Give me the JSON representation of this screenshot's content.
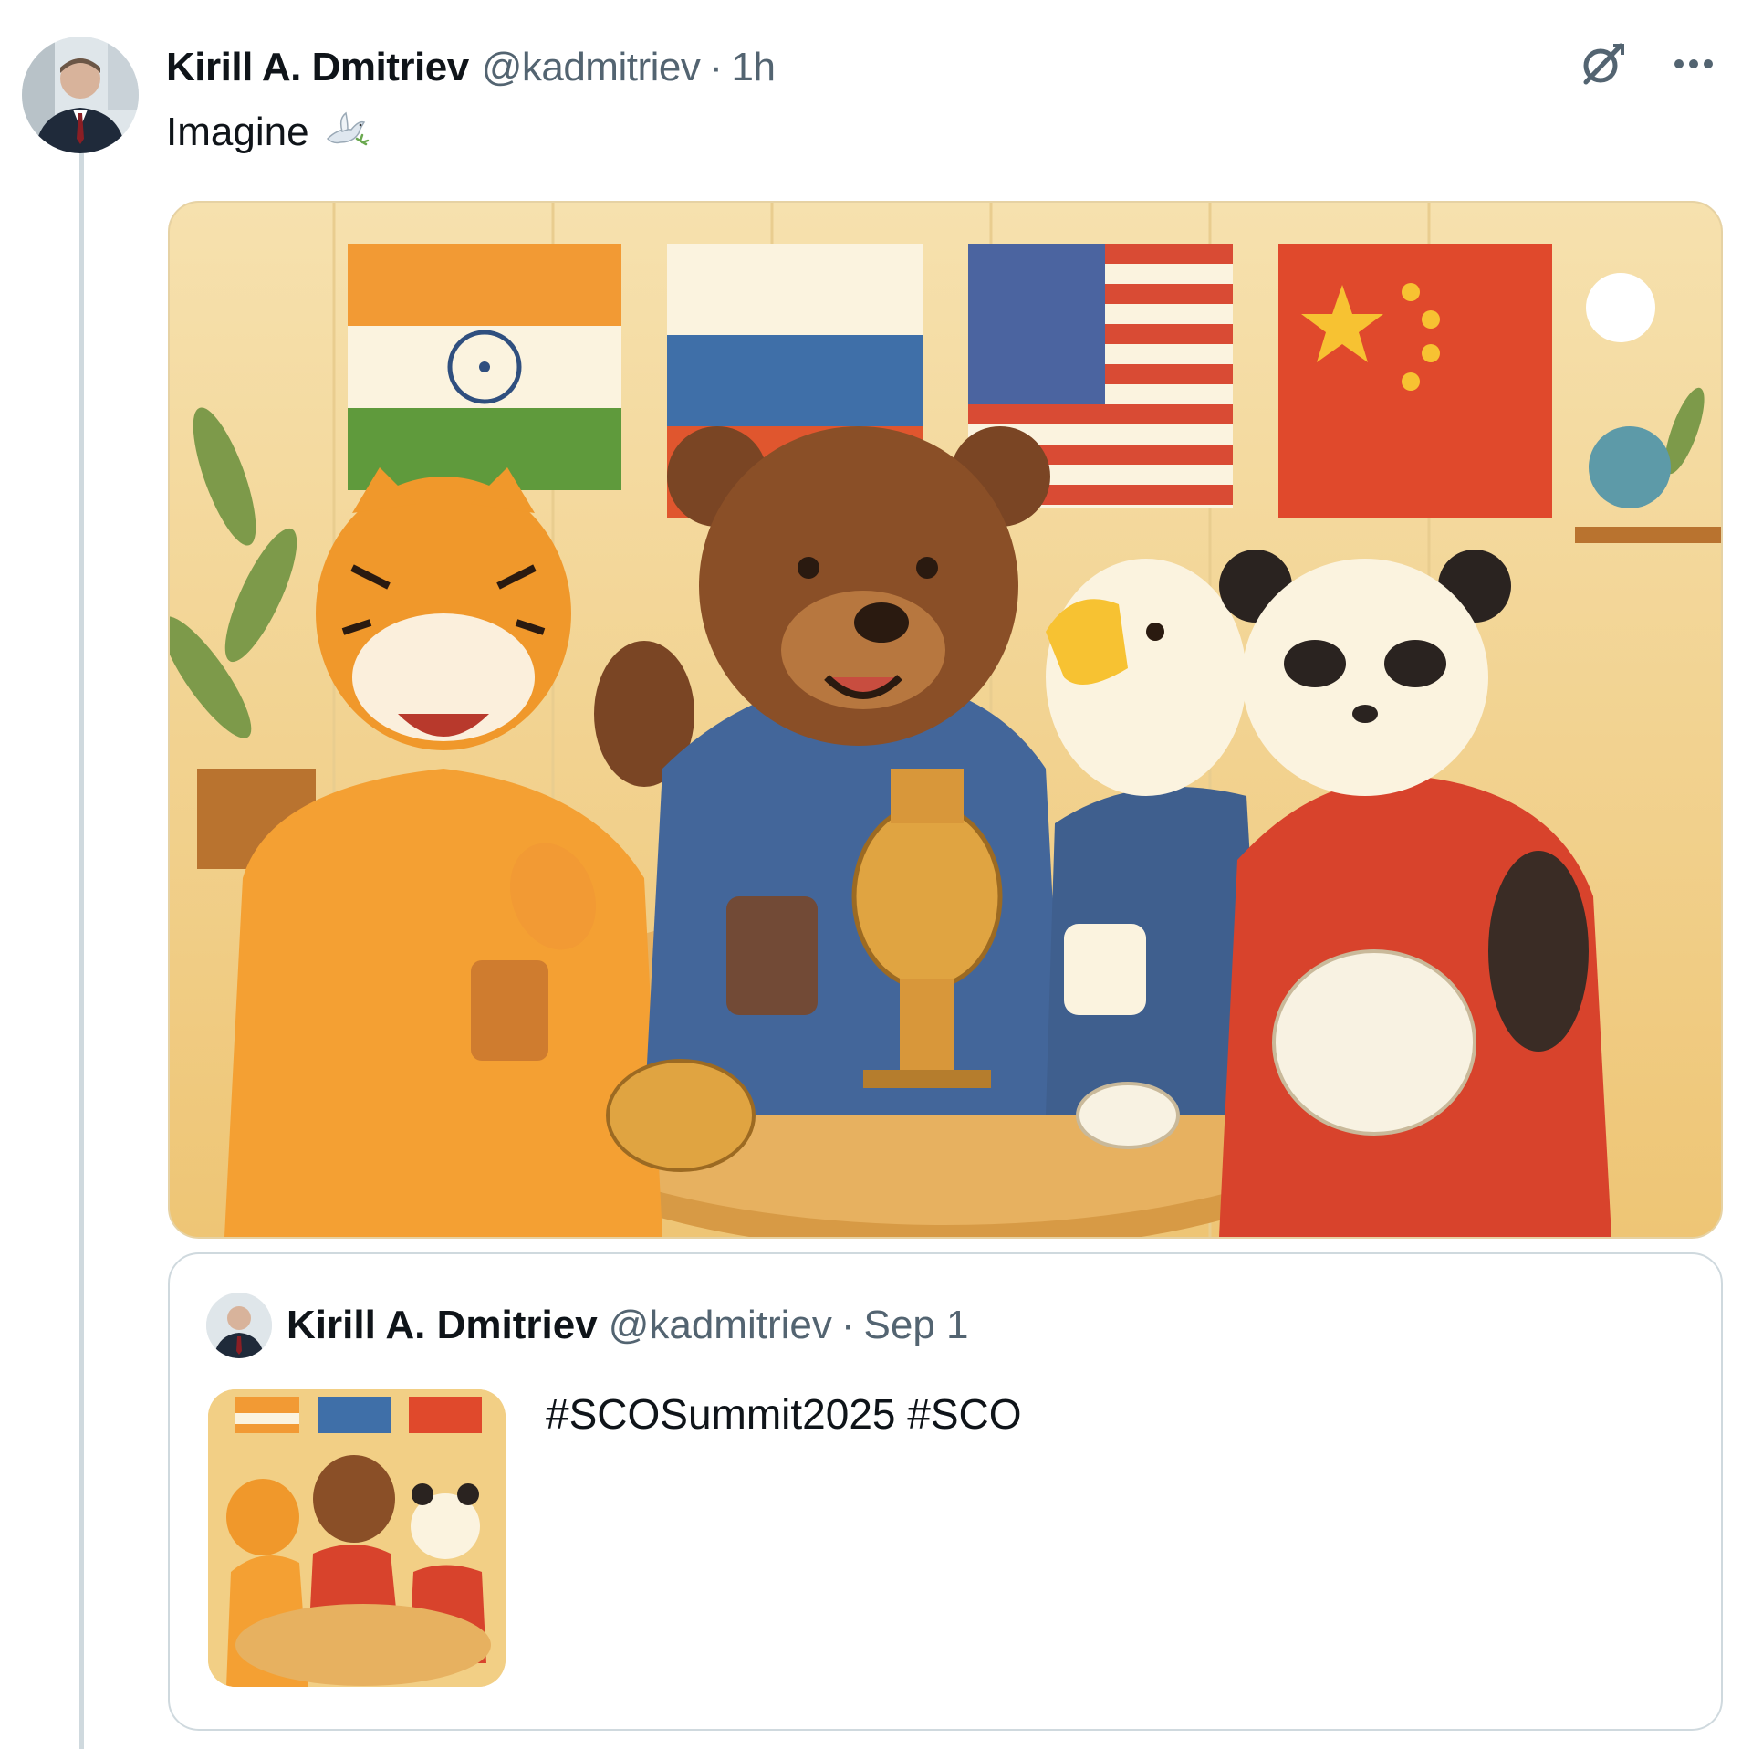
{
  "post": {
    "author_name": "Kirill A. Dmitriev",
    "handle": "@kadmitriev",
    "separator": "·",
    "time": "1h",
    "text": "Imagine",
    "text_emoji": "dove-of-peace-icon",
    "icons": {
      "grok": "grok-icon",
      "more": "more-icon"
    },
    "media": {
      "flags": [
        "India",
        "Russia",
        "United States",
        "China"
      ],
      "characters": [
        "tiger",
        "bear",
        "eagle",
        "panda"
      ]
    }
  },
  "quoted_post": {
    "author_name": "Kirill A. Dmitriev",
    "handle": "@kadmitriev",
    "separator": "·",
    "time": "Sep 1",
    "text": "#SCOSummit2025 #SCO"
  },
  "colors": {
    "text_primary": "#0f1419",
    "text_secondary": "#536471",
    "border": "#cfd9de",
    "background": "#ffffff"
  }
}
